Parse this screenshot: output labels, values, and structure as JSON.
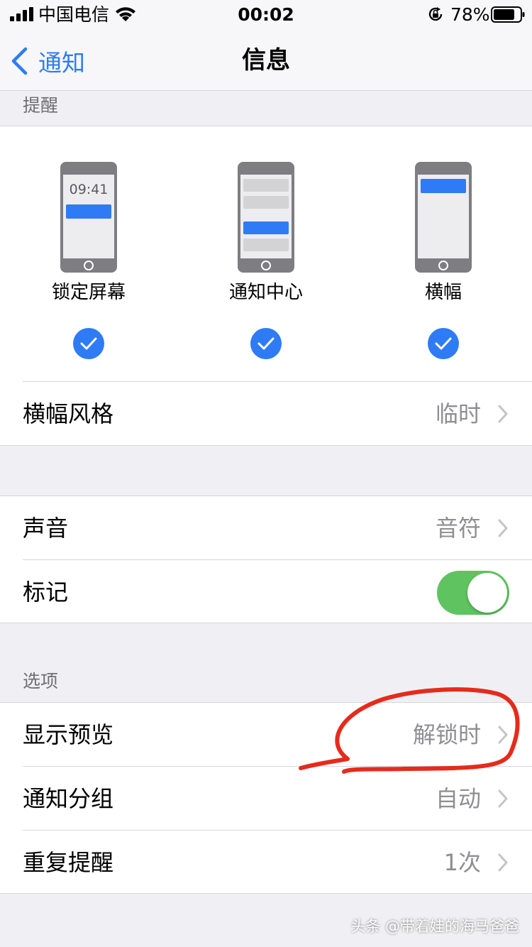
{
  "status_bar": {
    "carrier": "中国电信",
    "time": "00:02",
    "battery": "78%"
  },
  "nav": {
    "back_label": "通知",
    "title": "信息"
  },
  "alerts": {
    "header": "提醒",
    "lock_screen": {
      "label": "锁定屏幕",
      "clock": "09:41",
      "checked": true
    },
    "notification_center": {
      "label": "通知中心",
      "checked": true
    },
    "banners": {
      "label": "横幅",
      "checked": true
    }
  },
  "banner_style": {
    "label": "横幅风格",
    "value": "临时"
  },
  "sounds": {
    "label": "声音",
    "value": "音符"
  },
  "badges": {
    "label": "标记",
    "on": true
  },
  "options": {
    "header": "选项",
    "show_previews": {
      "label": "显示预览",
      "value": "解锁时"
    },
    "grouping": {
      "label": "通知分组",
      "value": "自动"
    },
    "repeat_alerts": {
      "label": "重复提醒",
      "value": "1次"
    }
  },
  "watermark": "头条 @带着娃的海马爸爸",
  "colors": {
    "accent": "#2f7bf5",
    "toggle_on": "#5fc45f",
    "annotation": "#e52b1c"
  }
}
